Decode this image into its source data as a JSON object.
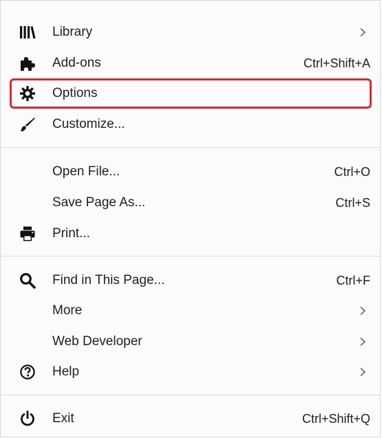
{
  "menu": {
    "items": [
      {
        "id": "library",
        "label": "Library",
        "shortcut": "",
        "submenu": true,
        "icon": "library-icon"
      },
      {
        "id": "addons",
        "label": "Add-ons",
        "shortcut": "Ctrl+Shift+A",
        "submenu": false,
        "icon": "puzzle-piece-icon"
      },
      {
        "id": "options",
        "label": "Options",
        "shortcut": "",
        "submenu": false,
        "icon": "gear-icon",
        "highlighted": true
      },
      {
        "id": "customize",
        "label": "Customize...",
        "shortcut": "",
        "submenu": false,
        "icon": "paintbrush-icon"
      },
      {
        "id": "open-file",
        "label": "Open File...",
        "shortcut": "Ctrl+O",
        "submenu": false,
        "icon": ""
      },
      {
        "id": "save-page-as",
        "label": "Save Page As...",
        "shortcut": "Ctrl+S",
        "submenu": false,
        "icon": ""
      },
      {
        "id": "print",
        "label": "Print...",
        "shortcut": "",
        "submenu": false,
        "icon": "printer-icon"
      },
      {
        "id": "find-in-page",
        "label": "Find in This Page...",
        "shortcut": "Ctrl+F",
        "submenu": false,
        "icon": "search-icon"
      },
      {
        "id": "more",
        "label": "More",
        "shortcut": "",
        "submenu": true,
        "icon": ""
      },
      {
        "id": "web-developer",
        "label": "Web Developer",
        "shortcut": "",
        "submenu": true,
        "icon": ""
      },
      {
        "id": "help",
        "label": "Help",
        "shortcut": "",
        "submenu": true,
        "icon": "help-circle-icon"
      },
      {
        "id": "exit",
        "label": "Exit",
        "shortcut": "Ctrl+Shift+Q",
        "submenu": false,
        "icon": "power-icon"
      }
    ]
  },
  "colors": {
    "highlight_border": "#d42a30",
    "text": "#1f1f1f",
    "separator": "#dcdcdc",
    "background": "#fbfbfb"
  }
}
